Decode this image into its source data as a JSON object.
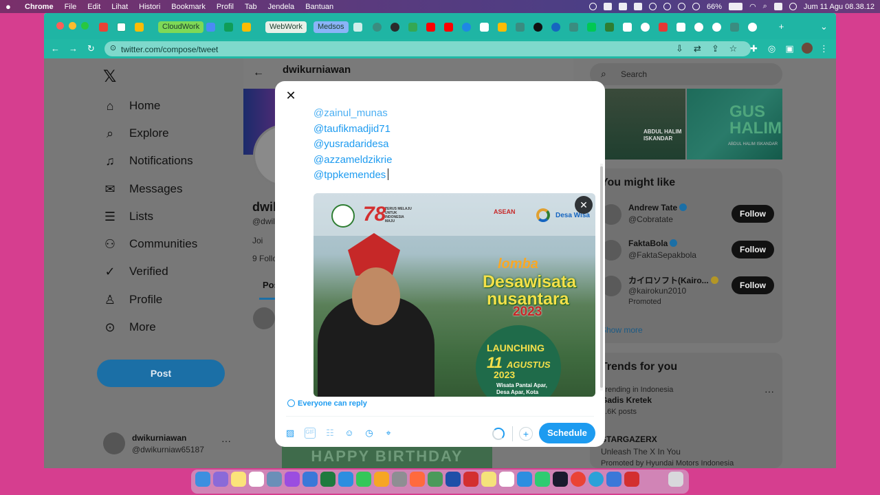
{
  "menubar": {
    "app": "Chrome",
    "items": [
      "File",
      "Edit",
      "Lihat",
      "Histori",
      "Bookmark",
      "Profil",
      "Tab",
      "Jendela",
      "Bantuan"
    ],
    "battery": "66%",
    "datetime": "Jum 11 Agu  08.38.12"
  },
  "browser": {
    "tab_groups": [
      "CloudWork",
      "WebWork",
      "Medsos"
    ],
    "url": "twitter.com/compose/tweet",
    "colors": {
      "frame": "#1fb5a4",
      "omnibox": "#7fd9cc"
    }
  },
  "nav": {
    "items": [
      {
        "label": "Home",
        "icon": "home-icon"
      },
      {
        "label": "Explore",
        "icon": "search-icon"
      },
      {
        "label": "Notifications",
        "icon": "bell-icon"
      },
      {
        "label": "Messages",
        "icon": "mail-icon"
      },
      {
        "label": "Lists",
        "icon": "list-icon"
      },
      {
        "label": "Communities",
        "icon": "people-icon"
      },
      {
        "label": "Verified",
        "icon": "verified-icon"
      },
      {
        "label": "Profile",
        "icon": "person-icon"
      },
      {
        "label": "More",
        "icon": "more-circle-icon"
      }
    ],
    "post_label": "Post",
    "account": {
      "name": "dwikurniawan",
      "handle": "@dwikurniaw65187"
    }
  },
  "profile": {
    "header_name": "dwikurniawan",
    "name_partial": "dwil",
    "handle_partial": "@dwil",
    "joined_partial": "Joi",
    "following_partial": "9 Follo",
    "tab_partial": "Pos",
    "banner_text": "HAPPY BIRTHDAY"
  },
  "sidebar": {
    "search_placeholder": "Search",
    "photo1_caption": "ABDUL HALIM ISKANDAR",
    "photo2_big": "GUS HALIM",
    "photo2_small": "ABDUL HALIM ISKANDAR",
    "who_title": "You might like",
    "who": [
      {
        "name": "Andrew Tate",
        "handle": "@Cobratate",
        "follow": "Follow",
        "badge": "blue"
      },
      {
        "name": "FaktaBola",
        "handle": "@FaktaSepakbola",
        "follow": "Follow",
        "badge": "blue"
      },
      {
        "name": "カイロソフト(Kairo...",
        "handle": "@kairokun2010",
        "follow": "Follow",
        "badge": "gold",
        "promoted": "Promoted"
      }
    ],
    "show_more": "Show more",
    "trends_title": "Trends for you",
    "trends": [
      {
        "context": "Trending in Indonesia",
        "title": "Gadis Kretek",
        "count": "2.6K posts"
      },
      {
        "context": "",
        "title": "STARGAZERX",
        "subtitle": "Unleash The X In You",
        "count": "Promoted by Hyundai Motors Indonesia"
      }
    ]
  },
  "compose": {
    "mentions": [
      "@zainul_munas",
      "@taufikmadjid71",
      "@yusradaridesa",
      "@azzameldzikrie",
      "@tppkemendes"
    ],
    "reply_setting": "Everyone can reply",
    "schedule_label": "Schedule",
    "media": {
      "logo_78": "78",
      "logo_78_text": "TERUS MELAJU UNTUK INDONESIA MAJU",
      "asean": "ASEAN",
      "desa": "Desa Wisa",
      "lomba": "lomba",
      "title1": "Desawisata",
      "title2": "nusantara",
      "year": "2023",
      "launch_label": "LAUNCHING",
      "launch_day": "11",
      "launch_month": "AGUSTUS",
      "launch_year": "2023",
      "launch_place": "Wisata Pantai Apar, Desa Apar, Kota Pariaman, Sumatera Barat"
    }
  }
}
